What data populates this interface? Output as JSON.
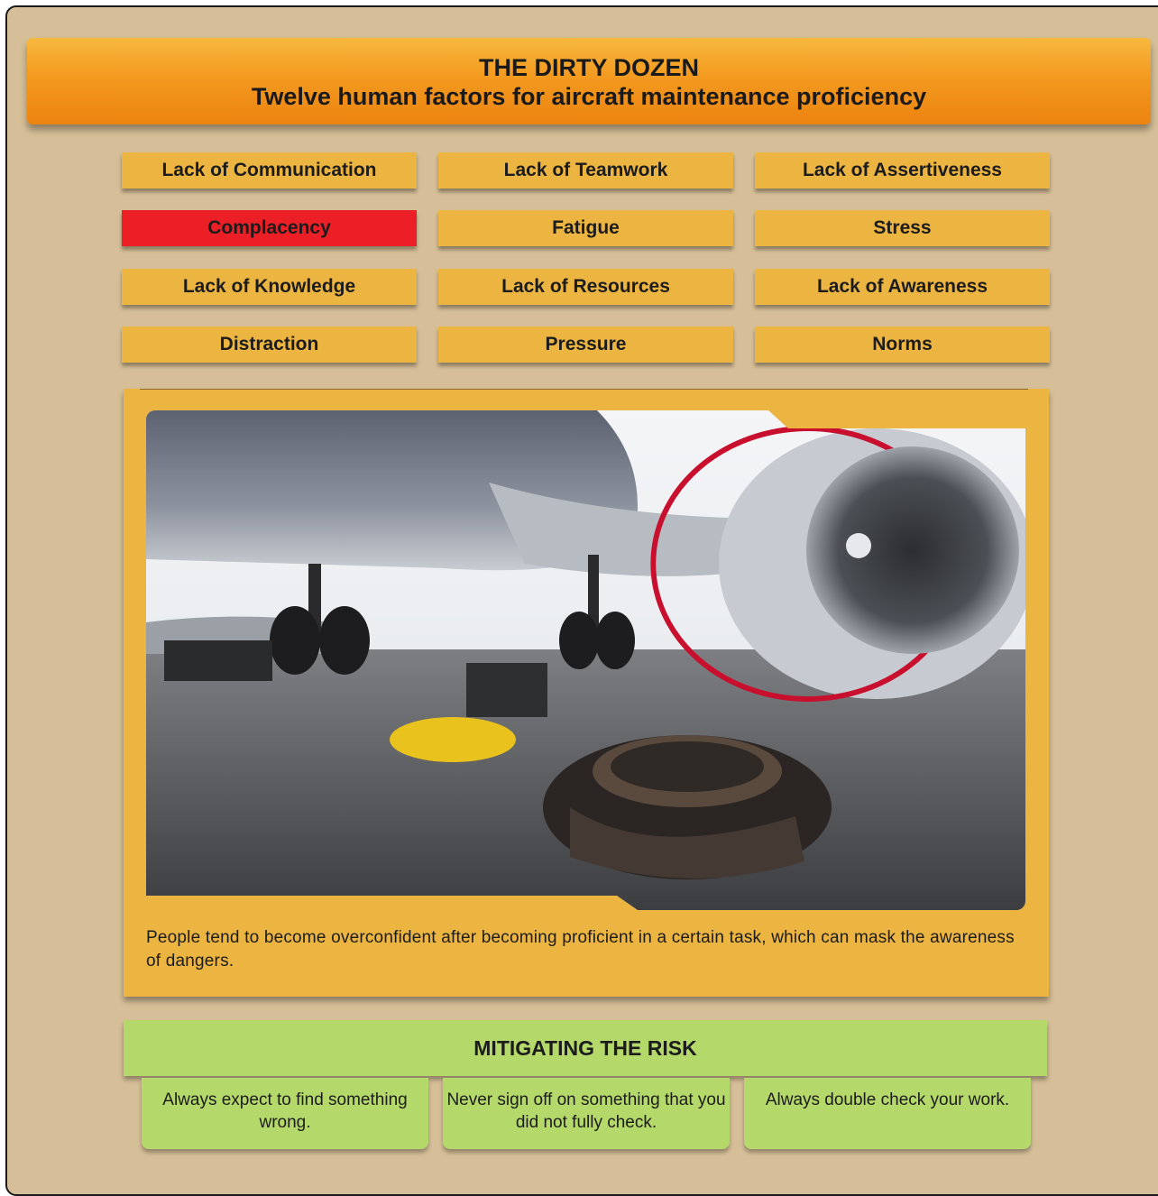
{
  "header": {
    "title": "THE DIRTY DOZEN",
    "subtitle": "Twelve human factors for aircraft maintenance proficiency"
  },
  "factors": [
    "Lack of Communication",
    "Lack of Teamwork",
    "Lack of Assertiveness",
    "Complacency",
    "Fatigue",
    "Stress",
    "Lack of Knowledge",
    "Lack of Resources",
    "Lack of Awareness",
    "Distraction",
    "Pressure",
    "Norms"
  ],
  "selected_factor": "Complacency",
  "description": "People tend to become overconfident after becoming proficient in a certain task, which can mask the awareness of dangers.",
  "mitigation": {
    "title": "MITIGATING THE RISK",
    "tips": [
      "Always expect to find something wrong.",
      "Never sign off on something that you did not fully check.",
      "Always double check your work."
    ]
  },
  "colors": {
    "background": "#d6bf98",
    "factor_button": "#ecb441",
    "factor_selected": "#ec1f27",
    "banner": "#f39a1f",
    "mitigation": "#b5d86b"
  }
}
